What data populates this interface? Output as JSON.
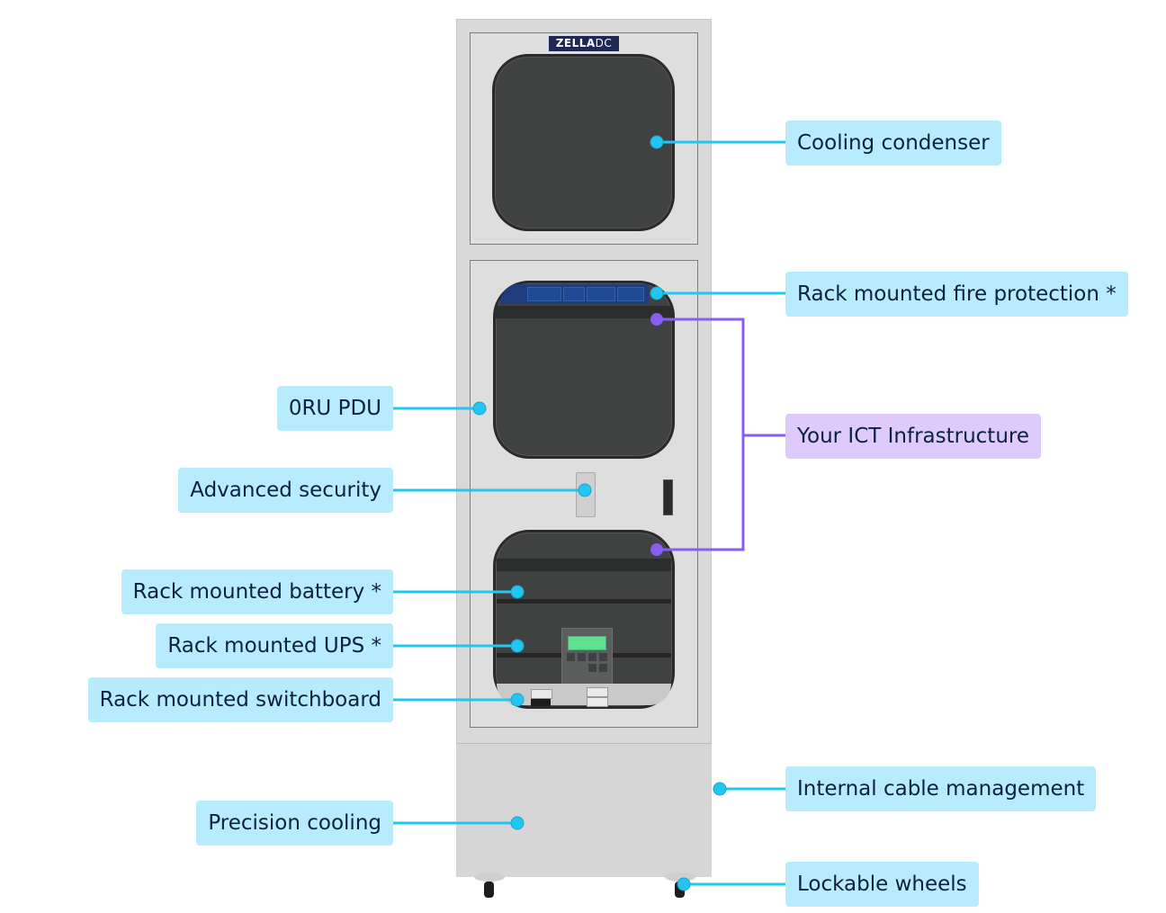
{
  "product": {
    "brand_logo": {
      "primary": "ZELLA",
      "secondary": "DC"
    }
  },
  "colors": {
    "callout_cyan": "#22c6f0",
    "callout_cyan_bg": "#b8ecfc",
    "callout_purple": "#8b5cf0",
    "callout_purple_bg": "#decbfb",
    "label_text": "#0d1f45",
    "cabinet_body": "#d9d9d9",
    "window_glass": "#404241",
    "ups_screen": "#5fe08f"
  },
  "callouts": {
    "right": [
      {
        "id": "cooling-condenser",
        "text": "Cooling condenser",
        "style": "cyan"
      },
      {
        "id": "fire-protection",
        "text": "Rack mounted fire protection *",
        "style": "cyan"
      },
      {
        "id": "ict-infrastructure",
        "text": "Your ICT Infrastructure",
        "style": "purple"
      },
      {
        "id": "cable-management",
        "text": "Internal cable management",
        "style": "cyan"
      },
      {
        "id": "lockable-wheels",
        "text": "Lockable wheels",
        "style": "cyan"
      }
    ],
    "left": [
      {
        "id": "oru-pdu",
        "text": "0RU PDU",
        "style": "cyan"
      },
      {
        "id": "advanced-security",
        "text": "Advanced security",
        "style": "cyan"
      },
      {
        "id": "rack-battery",
        "text": "Rack mounted battery *",
        "style": "cyan"
      },
      {
        "id": "rack-ups",
        "text": "Rack mounted UPS *",
        "style": "cyan"
      },
      {
        "id": "rack-switchboard",
        "text": "Rack mounted switchboard",
        "style": "cyan"
      },
      {
        "id": "precision-cooling",
        "text": "Precision cooling",
        "style": "cyan"
      }
    ]
  }
}
